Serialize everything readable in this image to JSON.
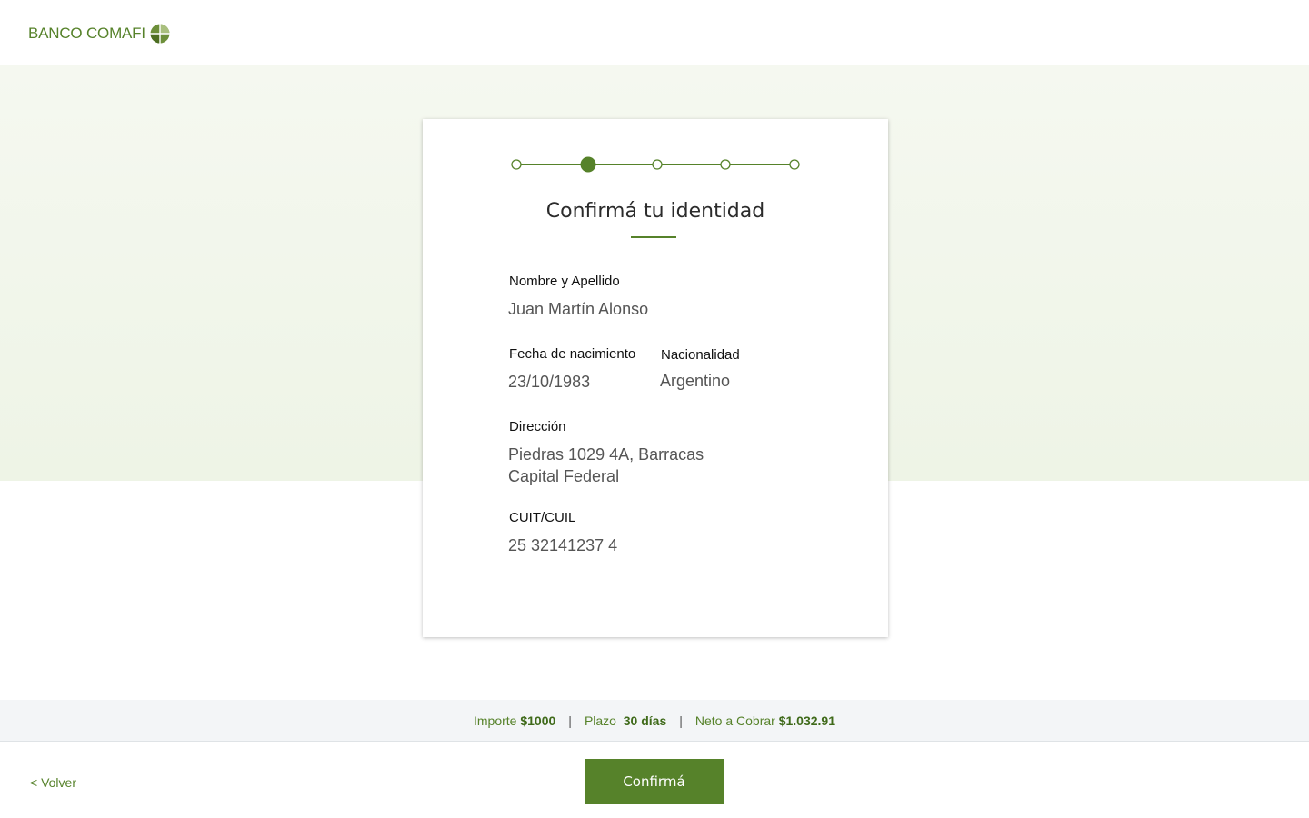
{
  "header": {
    "brand": "BANCO COMAFI",
    "logo_icon": "comafi-globe-icon"
  },
  "stepper": {
    "total_steps": 5,
    "current_step": 2,
    "active_color": "#56822a"
  },
  "card": {
    "title": "Confirmá tu identidad",
    "fields": {
      "name": {
        "label": "Nombre y Apellido",
        "value": "Juan Martín Alonso"
      },
      "birthdate": {
        "label": "Fecha de nacimiento",
        "value": "23/10/1983"
      },
      "nationality": {
        "label": "Nacionalidad",
        "value": "Argentino"
      },
      "address": {
        "label": "Dirección",
        "line1": "Piedras 1029 4A, Barracas",
        "line2": "Capital Federal"
      },
      "cuit": {
        "label": "CUIT/CUIL",
        "value": "25 32141237 4"
      }
    }
  },
  "summary": {
    "amount_label": "Importe",
    "amount_value": "$1000",
    "term_label": "Plazo",
    "term_value": "30 días",
    "net_label": "Neto a Cobrar",
    "net_value": "$1.032.91",
    "separator": "|"
  },
  "footer": {
    "back_label": "< Volver",
    "confirm_label": "Confirmá"
  },
  "colors": {
    "brand_green": "#56822a",
    "band_background": "#eef4e6",
    "summary_background": "#f3f5f7"
  }
}
